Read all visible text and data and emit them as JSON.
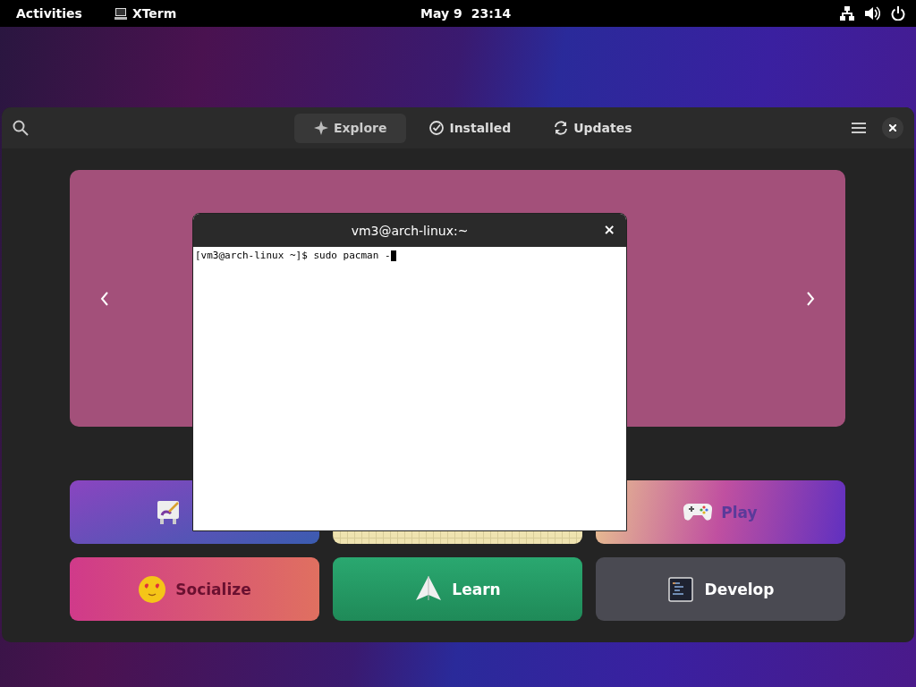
{
  "top_bar": {
    "activities": "Activities",
    "app_name": "XTerm",
    "date": "May 9",
    "time": "23:14"
  },
  "software_window": {
    "tabs": [
      {
        "label": "Explore",
        "kind": "explore",
        "selected": true
      },
      {
        "label": "Installed",
        "kind": "installed",
        "selected": false
      },
      {
        "label": "Updates",
        "kind": "updates",
        "selected": false
      }
    ],
    "categories": [
      {
        "kind": "art"
      },
      {
        "kind": "grid"
      },
      {
        "kind": "game",
        "label": "Play"
      },
      {
        "kind": "emoji",
        "label": "Socialize"
      },
      {
        "kind": "paper",
        "label": "Learn"
      },
      {
        "kind": "code",
        "label": "Develop"
      }
    ]
  },
  "terminal": {
    "title": "vm3@arch-linux:~",
    "close": "×",
    "prompt": "[vm3@arch-linux ~]$ sudo pacman -"
  }
}
